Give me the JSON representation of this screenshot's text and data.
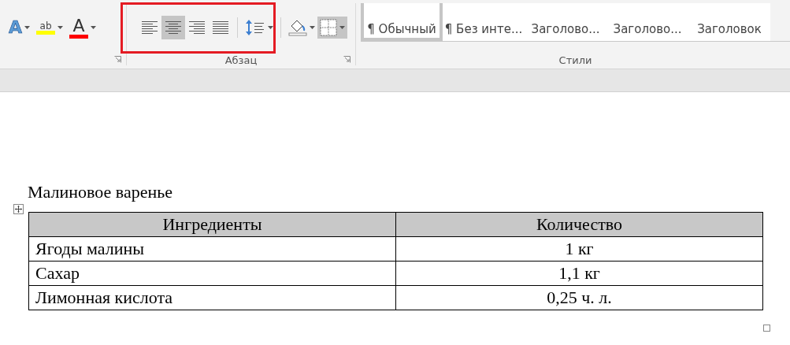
{
  "ribbon": {
    "font_group": {
      "text_effects": {
        "glyph": "A"
      },
      "highlight": {
        "glyph": "ab"
      },
      "font_color": {
        "glyph": "A"
      }
    },
    "paragraph_group": {
      "label": "Абзац",
      "alignment_buttons": [
        {
          "kind": "left",
          "selected": false
        },
        {
          "kind": "center",
          "selected": true
        },
        {
          "kind": "right",
          "selected": false
        },
        {
          "kind": "justify",
          "selected": false
        }
      ],
      "borders_button": {
        "selected": true
      }
    },
    "styles_group": {
      "label": "Стили",
      "items": [
        {
          "label": "¶ Обычный",
          "selected": true
        },
        {
          "label": "¶ Без инте...",
          "selected": false
        },
        {
          "label": "Заголово...",
          "selected": false
        },
        {
          "label": "Заголово...",
          "selected": false
        },
        {
          "label": "Заголовок",
          "selected": false
        }
      ]
    }
  },
  "document": {
    "title": "Малиновое варенье",
    "table": {
      "columns": [
        "Ингредиенты",
        "Количество"
      ],
      "rows": [
        [
          "Ягоды малины",
          "1 кг"
        ],
        [
          "Сахар",
          "1,1 кг"
        ],
        [
          "Лимонная кислота",
          "0,25 ч. л."
        ]
      ]
    }
  }
}
